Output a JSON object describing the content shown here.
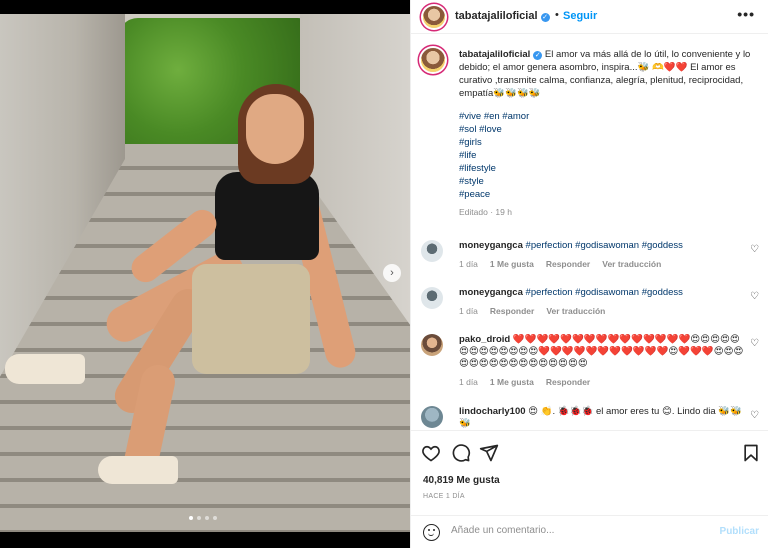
{
  "post": {
    "carousel_dots": 4,
    "carousel_active_index": 0,
    "next_arrow": "›"
  },
  "header": {
    "username": "tabatajaliloficial",
    "separator": "•",
    "follow_label": "Seguir",
    "more": "•••"
  },
  "caption": {
    "username": "tabatajaliloficial",
    "text_1": "El amor va más allá de lo útil, lo conveniente y lo debido; el amor genera asombro, inspira...🐝 🫶❤️❤️ El amor es curativo ,transmite calma, confianza, alegría, plenitud, reciprocidad, empatía🐝🐝🐝🐝",
    "hashtags": [
      "#vive #en #amor",
      "#sol #love",
      "#girls",
      "#life",
      "#lifestyle",
      "#style",
      "#peace"
    ],
    "edited_label": "Editado",
    "time": "19 h"
  },
  "comments": [
    {
      "username": "moneygangca",
      "text": "#perfection #godisawoman #goddess",
      "time": "1 día",
      "likes": "1 Me gusta",
      "reply": "Responder",
      "translate": "Ver traducción"
    },
    {
      "username": "moneygangca",
      "text": "#perfection #godisawoman #goddess",
      "time": "1 día",
      "likes": "",
      "reply": "Responder",
      "translate": "Ver traducción"
    },
    {
      "username": "pako_droid",
      "text": "❤️❤️❤️❤️❤️❤️❤️❤️❤️❤️❤️❤️❤️❤️❤️😍😍😍😍😍😍😍😍😍😍😍😍😍❤️❤️❤️❤️❤️❤️❤️❤️❤️❤️❤️😍❤️❤️❤️😍😍😍😍😍😍😍😍😍😍😍😍😍😍😍😍",
      "time": "1 día",
      "likes": "1 Me gusta",
      "reply": "Responder",
      "translate": ""
    },
    {
      "username": "lindocharly100",
      "text": "😍 👏. 🐞🐞🐞 el amor eres tu 😊. Lindo dia 🐝🐝🐝",
      "time": "",
      "likes": "",
      "reply": "",
      "translate": ""
    }
  ],
  "actions": {
    "likes_count": "40,819 Me gusta",
    "posted_ago": "HACE 1 DÍA"
  },
  "comment_box": {
    "placeholder": "Añade un comentario...",
    "publish_label": "Publicar"
  },
  "colors": {
    "link": "#00376b",
    "follow": "#0095f6",
    "publish_disabled": "#b2dffc",
    "muted": "#8e8e8e",
    "heart": "#ed4956"
  }
}
